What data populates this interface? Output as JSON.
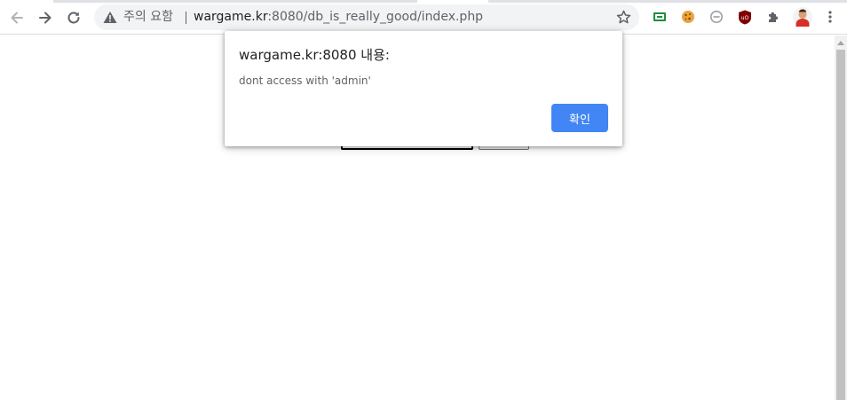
{
  "browser": {
    "security_label": "주의 요함",
    "url_host": "wargame.kr",
    "url_rest": ":8080/db_is_really_good/index.php",
    "colors": {
      "omnibox_bg": "#f1f3f4",
      "toolbar_bg": "#ffffff"
    },
    "nav": {
      "back_icon": "back-arrow-icon",
      "forward_icon": "forward-arrow-icon",
      "reload_icon": "reload-icon"
    },
    "extensions": [
      "screen-capture-icon",
      "cookie-icon",
      "minus-circle-icon",
      "ublock-icon",
      "puzzle-icon",
      "avatar",
      "kebab-menu-icon"
    ]
  },
  "dialog": {
    "title": "wargame.kr:8080 내용:",
    "message": "dont access with 'admin'",
    "ok_label": "확인",
    "ok_color": "#4285f4"
  }
}
